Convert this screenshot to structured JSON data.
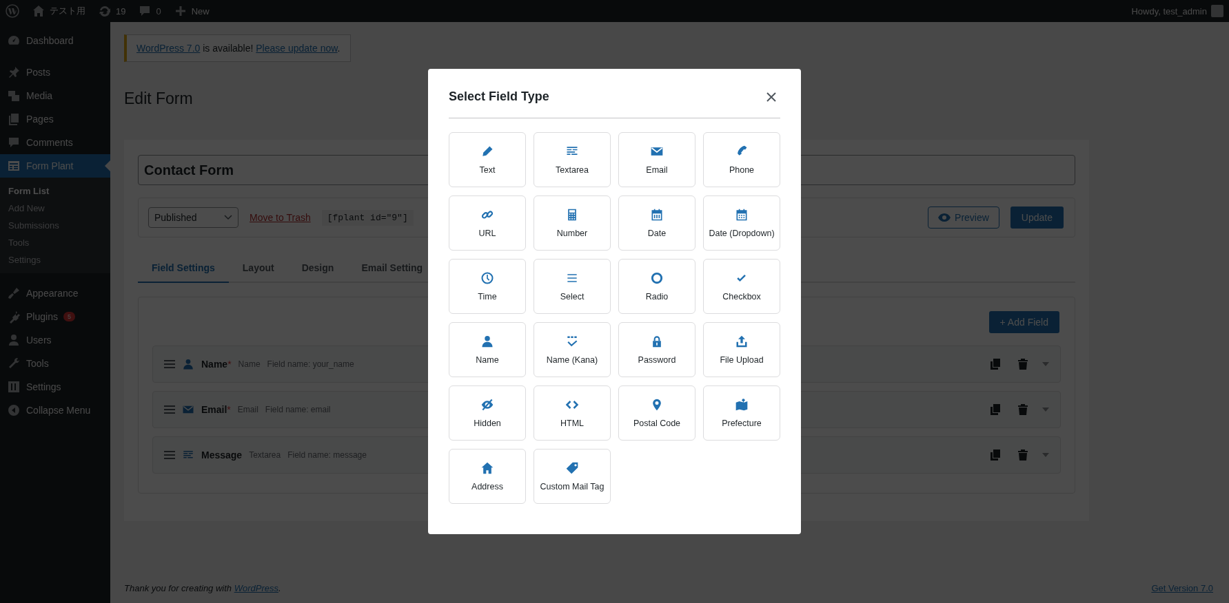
{
  "admin_bar": {
    "site_name": "テスト用",
    "updates": "19",
    "comments": "0",
    "new_label": "New",
    "greeting": "Howdy, test_admin"
  },
  "sidebar": {
    "items": [
      {
        "label": "Dashboard",
        "selected": false
      },
      {
        "label": "Posts",
        "selected": false
      },
      {
        "label": "Media",
        "selected": false
      },
      {
        "label": "Pages",
        "selected": false
      },
      {
        "label": "Comments",
        "selected": false
      },
      {
        "label": "Form Plant",
        "selected": true,
        "children": [
          {
            "label": "Form List",
            "selected": true
          },
          {
            "label": "Add New",
            "selected": false
          },
          {
            "label": "Submissions",
            "selected": false
          },
          {
            "label": "Tools",
            "selected": false
          },
          {
            "label": "Settings",
            "selected": false
          }
        ]
      },
      {
        "label": "Appearance",
        "selected": false
      },
      {
        "label": "Plugins",
        "selected": false,
        "badge": "5"
      },
      {
        "label": "Users",
        "selected": false
      },
      {
        "label": "Tools",
        "selected": false
      },
      {
        "label": "Settings",
        "selected": false
      }
    ],
    "collapse_label": "Collapse Menu"
  },
  "notice": {
    "version_link": "WordPress 7.0",
    "message": "is available!",
    "update_link": "Please update now",
    "suffix": "."
  },
  "page_title": "Edit Form",
  "form": {
    "title_value": "Contact Form",
    "status": "Published",
    "trash_link": "Move to Trash",
    "shortcode": "[fplant id=\"9\"]",
    "preview_label": "Preview",
    "update_label": "Update",
    "tabs": [
      {
        "label": "Field Settings",
        "selected": true
      },
      {
        "label": "Layout",
        "selected": false
      },
      {
        "label": "Design",
        "selected": false
      },
      {
        "label": "Email Setting",
        "selected": false
      }
    ],
    "add_field_label": "+ Add Field",
    "fields": [
      {
        "label": "Name",
        "required_mark": "*",
        "type": "Name",
        "field_name": "Field name: your_name"
      },
      {
        "label": "Email",
        "required_mark": "*",
        "type": "Email",
        "field_name": "Field name: email"
      },
      {
        "label": "Message",
        "type": "Textarea",
        "field_name": "Field name: message"
      }
    ]
  },
  "footer": {
    "text": "Thank you for creating with",
    "link": "WordPress",
    "suffix": ".",
    "version_link": "Get Version 7.0"
  },
  "modal": {
    "title": "Select Field Type",
    "field_types": [
      "Text",
      "Textarea",
      "Email",
      "Phone",
      "URL",
      "Number",
      "Date",
      "Date (Dropdown)",
      "Time",
      "Select",
      "Radio",
      "Checkbox",
      "Name",
      "Name (Kana)",
      "Password",
      "File Upload",
      "Hidden",
      "HTML",
      "Postal Code",
      "Prefecture",
      "Address",
      "Custom Mail Tag"
    ]
  }
}
